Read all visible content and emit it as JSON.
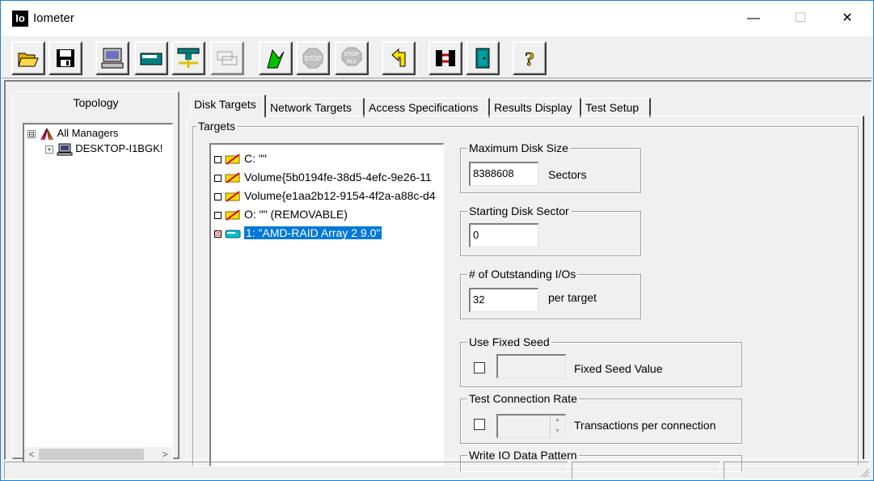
{
  "window": {
    "app_icon_text": "Io",
    "title": "Iometer",
    "controls": {
      "minimize": "—",
      "maximize": "☐",
      "close": "✕"
    }
  },
  "toolbar": {
    "buttons": [
      "open-icon",
      "save-icon",
      "start-manager-icon",
      "new-disk-worker-icon",
      "new-network-worker-icon",
      "copy-worker-icon",
      "start-tests-icon",
      "stop-icon",
      "stop-all-icon",
      "reset-workers-icon",
      "disconnect-icon",
      "exit-icon",
      "help-icon"
    ],
    "stop_label": "STOP",
    "stop_all_label_1": "STOP",
    "stop_all_label_2": "ALL",
    "help_label": "?"
  },
  "topology": {
    "label": "Topology",
    "items": [
      {
        "label": "All Managers",
        "expander": "⊟"
      },
      {
        "label": "DESKTOP-I1BGK!",
        "expander": "+"
      }
    ],
    "scroll_left": "<",
    "scroll_right": ">"
  },
  "tabs": [
    "Disk Targets",
    "Network Targets",
    "Access Specifications",
    "Results Display",
    "Test Setup"
  ],
  "targets": {
    "title": "Targets",
    "items": [
      {
        "label": "C: \"\"",
        "checked": false,
        "type": "unprepared-drive"
      },
      {
        "label": "Volume{5b0194fe-38d5-4efc-9e26-11",
        "checked": false,
        "type": "unprepared-drive"
      },
      {
        "label": "Volume{e1aa2b12-9154-4f2a-a88c-d4",
        "checked": false,
        "type": "unprepared-drive"
      },
      {
        "label": "O: \"\" (REMOVABLE)",
        "checked": false,
        "type": "unprepared-drive"
      },
      {
        "label": "1: \"AMD-RAID Array 2 9.0\"",
        "checked": true,
        "type": "physical-disk"
      }
    ],
    "check_mark": "☒"
  },
  "max_disk_size": {
    "title": "Maximum Disk Size",
    "value": "8388608",
    "unit": "Sectors"
  },
  "starting_sector": {
    "title": "Starting Disk Sector",
    "value": "0"
  },
  "outstanding_ios": {
    "title": "# of Outstanding I/Os",
    "value": "32",
    "unit": "per target"
  },
  "fixed_seed": {
    "title": "Use Fixed Seed",
    "value": "",
    "label": "Fixed Seed Value"
  },
  "connection_rate": {
    "title": "Test Connection Rate",
    "value": "",
    "label": "Transactions per connection"
  },
  "write_io": {
    "title": "Write IO Data Pattern"
  },
  "colors": {
    "accent": "#0078d7",
    "window_border": "#1883d7",
    "icon_teal": "#007f7f"
  }
}
